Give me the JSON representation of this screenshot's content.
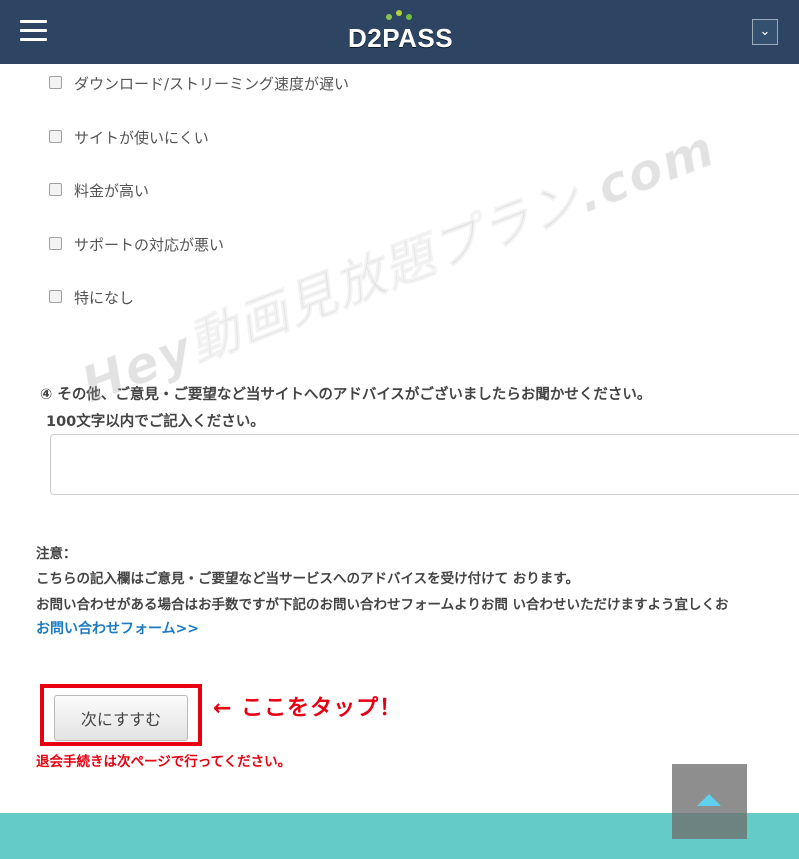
{
  "header": {
    "logo_text": "D2PASS",
    "menu_icon": "hamburger-icon",
    "dropdown_icon": "chevron-down-icon",
    "dropdown_glyph": "⌄"
  },
  "options": [
    {
      "label": "ダウンロード/ストリーミング速度が遅い"
    },
    {
      "label": "サイトが使いにくい"
    },
    {
      "label": "料金が高い"
    },
    {
      "label": "サポートの対応が悪い"
    },
    {
      "label": "特になし"
    }
  ],
  "question4": {
    "title": "④ その他、ご意見・ご要望など当サイトへのアドバイスがございましたらお聞かせください。",
    "subtitle": "100文字以内でご記入ください。",
    "value": ""
  },
  "notes": {
    "heading": "注意：",
    "line1": "こちらの記入欄はご意見・ご要望など当サービスへのアドバイスを受け付けて おります。",
    "line2": "お問い合わせがある場合はお手数ですが下記のお問い合わせフォームよりお問 い合わせいただけますよう宜しくお",
    "link": "お問い合わせフォーム>>"
  },
  "next_button": {
    "label": "次にすすむ"
  },
  "annotation": {
    "text": "← ここをタップ！"
  },
  "warning": "退会手続きは次ページで行ってください。",
  "watermark": "Hey動画見放題プラン.com",
  "colors": {
    "header_bg": "#2d4462",
    "accent_red": "#e60012",
    "link_blue": "#1a7bc4",
    "footer_teal": "#65cbc9",
    "scroll_top_arrow": "#5fd0ee"
  },
  "scroll_top_icon": "arrow-up-icon"
}
